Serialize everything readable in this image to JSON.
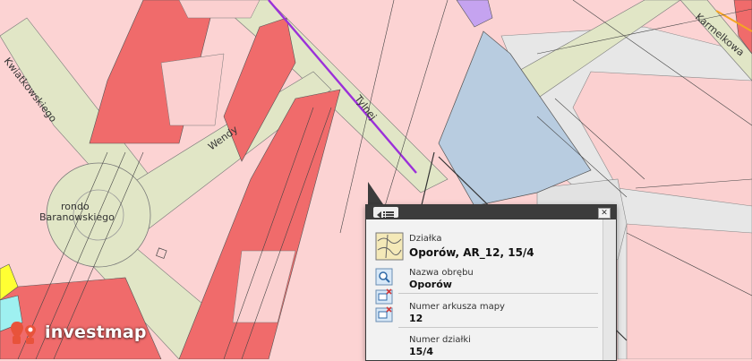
{
  "map": {
    "streets": {
      "kwiatkowskiego": "Kwiatkowskiego",
      "wendy": "Wendy",
      "tylnej": "Tylnej",
      "karmelkowa": "Karmelkowa"
    },
    "place": {
      "line1": "rondo",
      "line2": "Baranowskiego"
    }
  },
  "brand": {
    "name": "investmap",
    "accent": "#e8533b"
  },
  "popup": {
    "list_icon": "list-icon",
    "close_label": "✕",
    "parcel": {
      "label": "Działka",
      "value": "Oporów, AR_12, 15/4"
    },
    "fields": [
      {
        "label": "Nazwa obrębu",
        "value": "Oporów",
        "icon": "zoom-icon"
      },
      {
        "label": "Numer arkusza mapy",
        "value": "12",
        "icon": "map-sheet-icon"
      },
      {
        "label": "Numer działki",
        "value": "15/4",
        "icon": "parcel-number-icon"
      }
    ]
  },
  "colors": {
    "residential": "#fcd3d3",
    "dense": "#f06b6b",
    "road": "#e1e6c6",
    "public": "#b8cce0",
    "grey": "#e6e6e6",
    "purple": "#9b30d9"
  }
}
